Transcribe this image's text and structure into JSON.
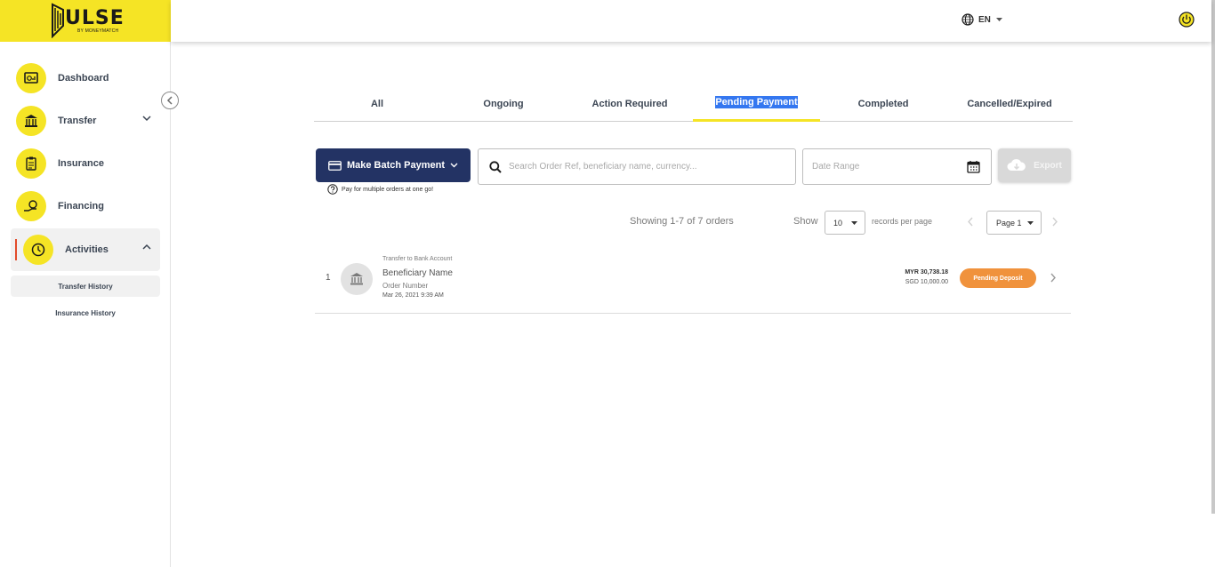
{
  "brand": {
    "name": "ULSE",
    "tagline": "BY MONEYMATCH",
    "color": "#f5e425"
  },
  "sidebar": {
    "items": [
      {
        "label": "Dashboard",
        "icon": "dashboard-icon"
      },
      {
        "label": "Transfer",
        "icon": "bank-icon",
        "has_chevron": true
      },
      {
        "label": "Insurance",
        "icon": "clipboard-icon"
      },
      {
        "label": "Financing",
        "icon": "hand-coin-icon"
      },
      {
        "label": "Activities",
        "icon": "activity-clock-icon",
        "active": true,
        "expanded": true
      }
    ],
    "sub_items": [
      {
        "label": "Transfer History",
        "active": true
      },
      {
        "label": "Insurance History"
      }
    ]
  },
  "header": {
    "language": "EN"
  },
  "tabs": [
    {
      "label": "All"
    },
    {
      "label": "Ongoing"
    },
    {
      "label": "Action Required"
    },
    {
      "label": "Pending Payment",
      "active": true
    },
    {
      "label": "Completed"
    },
    {
      "label": "Cancelled/Expired"
    }
  ],
  "toolbar": {
    "batch_button": "Make Batch Payment",
    "batch_hint": "Pay for multiple orders at one go!",
    "search_placeholder": "Search Order Ref, beneficiary name, currency...",
    "date_placeholder": "Date Range",
    "export_label": "Export"
  },
  "pagination": {
    "showing": "Showing 1-7 of 7 orders",
    "show_label": "Show",
    "per_page": "10",
    "records_label": "records per page",
    "page": "Page 1"
  },
  "orders": [
    {
      "index": "1",
      "type": "Transfer to Bank Account",
      "beneficiary": "Beneficiary Name",
      "order_number": "Order Number",
      "date": "Mar 26, 2021 9:39 AM",
      "amount_primary": "MYR 30,738.18",
      "amount_secondary": "SGD 10,000.00",
      "status": "Pending Deposit",
      "status_color": "#f0923c"
    }
  ],
  "colors": {
    "navy": "#233364",
    "accent": "#f5e425",
    "active_bar": "#e24c2b",
    "selection": "#3477f0"
  }
}
